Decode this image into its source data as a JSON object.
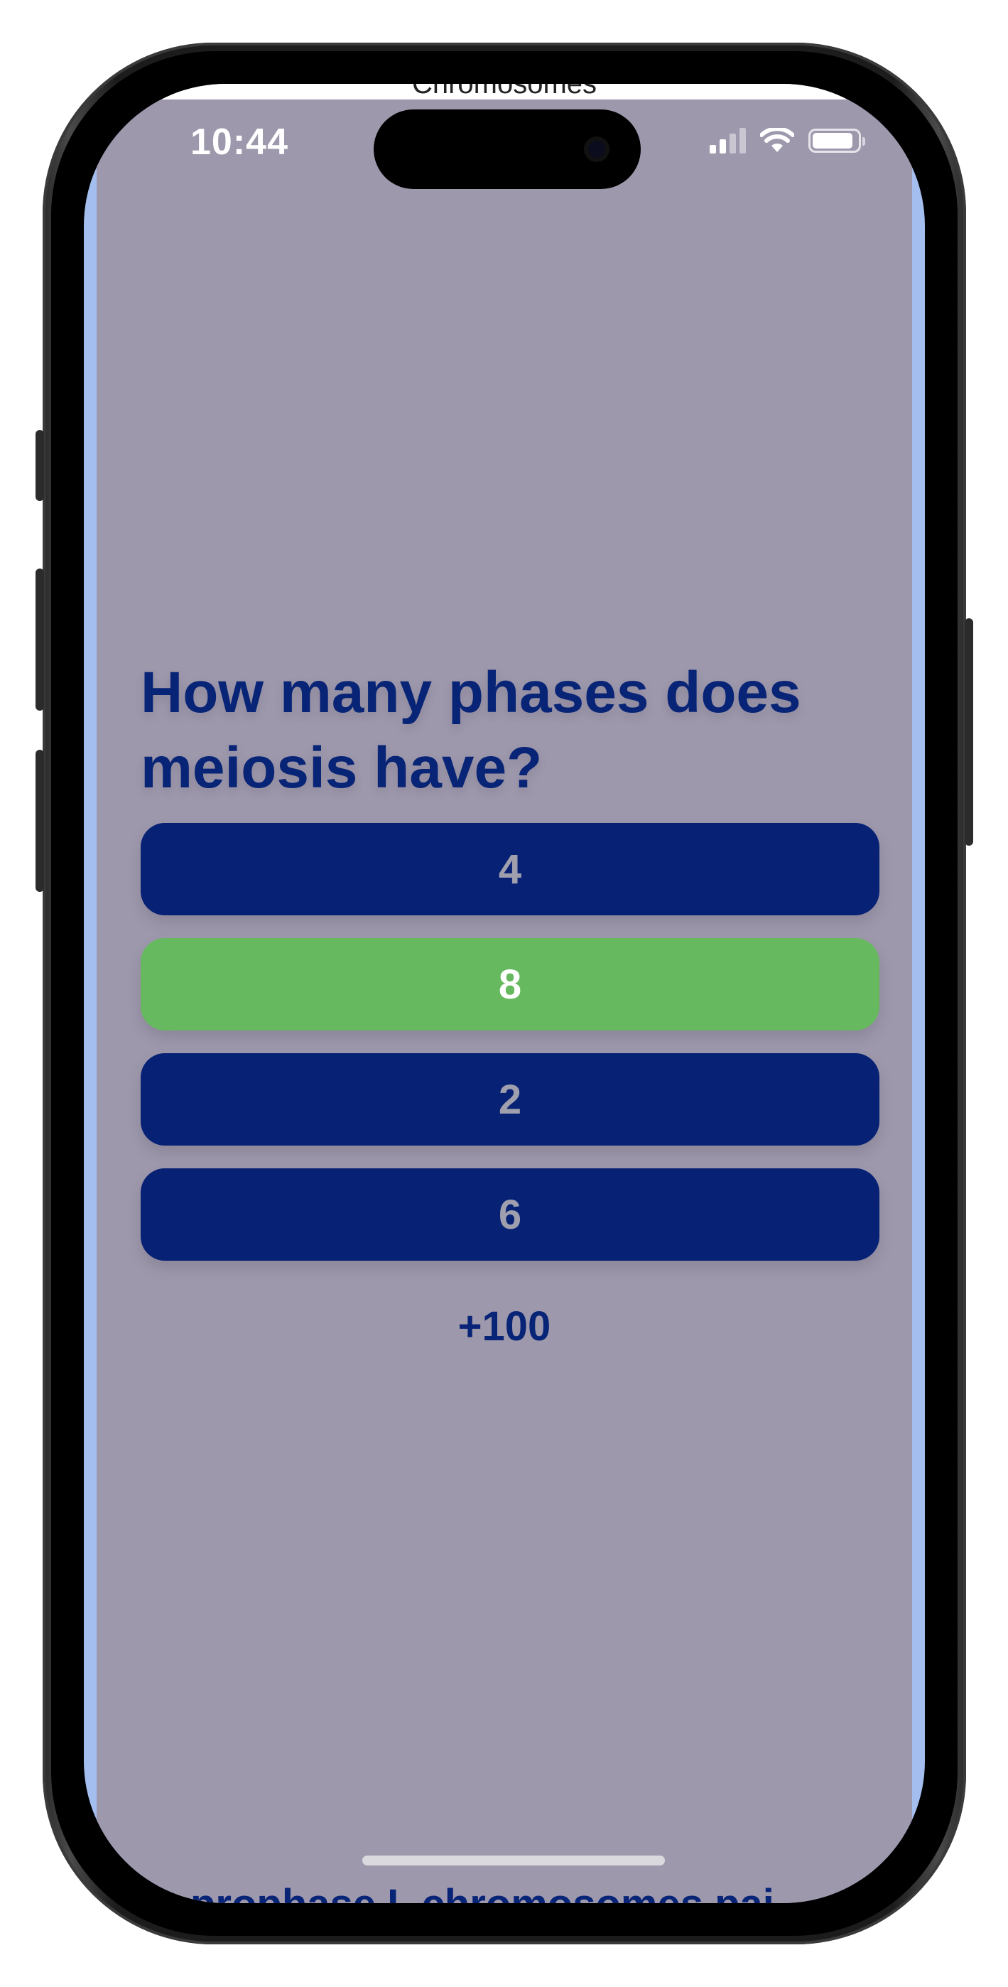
{
  "status_bar": {
    "time": "10:44",
    "icons": [
      "cellular-signal-icon",
      "wifi-icon",
      "battery-icon"
    ]
  },
  "top_peek": {
    "text": "Chromosomes"
  },
  "quiz": {
    "question": "How many phases does meiosis have?",
    "answers": [
      {
        "label": "4",
        "state": "default"
      },
      {
        "label": "8",
        "state": "correct"
      },
      {
        "label": "2",
        "state": "default"
      },
      {
        "label": "6",
        "state": "default"
      }
    ],
    "score_delta": "+100"
  },
  "bottom_peek": {
    "text": "prophase I, chromosomes pai"
  },
  "colors": {
    "background": "#9e98ad",
    "primary": "#082476",
    "answer_default": "#072275",
    "answer_correct": "#66b95e",
    "answer_text_muted": "#9f9fae",
    "edge_accent": "#a4bfef"
  }
}
